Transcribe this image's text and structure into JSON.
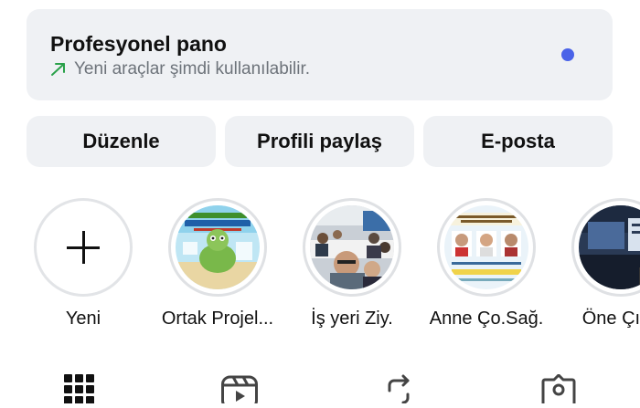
{
  "dashboard": {
    "title": "Profesyonel pano",
    "subtitle": "Yeni araçlar şimdi kullanılabilir.",
    "icon": "trending-up-arrow-icon",
    "dot_color": "#4a63e8"
  },
  "actions": {
    "edit_label": "Düzenle",
    "share_label": "Profili paylaş",
    "email_label": "E-posta"
  },
  "highlights": [
    {
      "label": "Yeni",
      "icon": "plus-icon"
    },
    {
      "label": "Ortak Projel..."
    },
    {
      "label": "İş yeri Ziy."
    },
    {
      "label": "Anne Ço.Sağ."
    },
    {
      "label": "Öne Çıka"
    }
  ],
  "tabs": [
    {
      "icon": "grid-icon"
    },
    {
      "icon": "reels-icon"
    },
    {
      "icon": "repost-icon"
    },
    {
      "icon": "tagged-icon"
    }
  ],
  "colors": {
    "card_bg": "#eff1f4",
    "ring": "#dfe1e4",
    "accent": "#4a63e8"
  }
}
